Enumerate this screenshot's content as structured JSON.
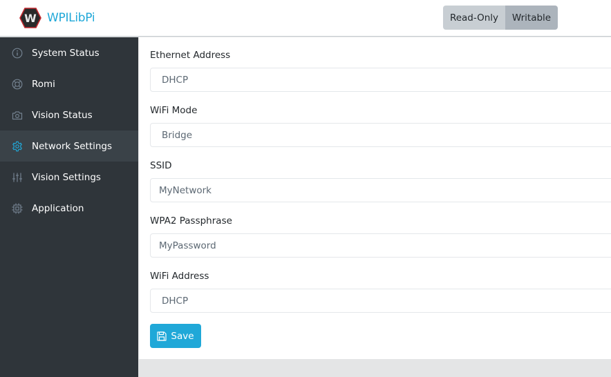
{
  "app": {
    "title": "WPILibPi",
    "brand_color": "#20a8d8"
  },
  "header": {
    "mode_toggle": [
      {
        "label": "Read-Only",
        "active": false
      },
      {
        "label": "Writable",
        "active": true
      }
    ]
  },
  "sidebar": {
    "items": [
      {
        "label": "System Status",
        "icon": "info-icon",
        "active": false
      },
      {
        "label": "Romi",
        "icon": "lifebuoy-icon",
        "active": false
      },
      {
        "label": "Vision Status",
        "icon": "camera-icon",
        "active": false
      },
      {
        "label": "Network Settings",
        "icon": "gear-icon",
        "active": true
      },
      {
        "label": "Vision Settings",
        "icon": "sliders-icon",
        "active": false
      },
      {
        "label": "Application",
        "icon": "chip-icon",
        "active": false
      }
    ]
  },
  "form": {
    "fields": [
      {
        "label": "Ethernet Address",
        "type": "select",
        "value": "DHCP"
      },
      {
        "label": "WiFi Mode",
        "type": "select",
        "value": "Bridge"
      },
      {
        "label": "SSID",
        "type": "text",
        "value": "MyNetwork"
      },
      {
        "label": "WPA2 Passphrase",
        "type": "text",
        "value": "MyPassword"
      },
      {
        "label": "WiFi Address",
        "type": "select",
        "value": "DHCP"
      }
    ],
    "save_label": "Save"
  }
}
